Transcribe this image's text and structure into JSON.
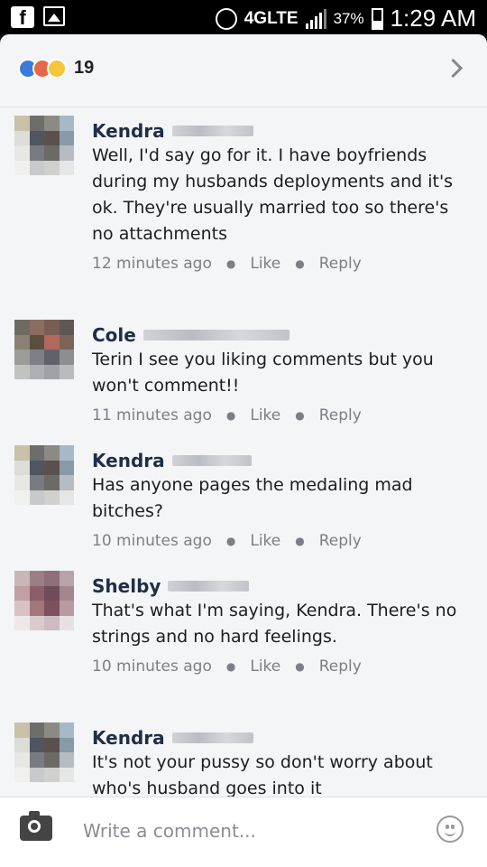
{
  "status_bar": {
    "network": "4GLTE",
    "battery": "37%",
    "time": "1:29 AM"
  },
  "reactions": {
    "icons": [
      "like-icon",
      "angry-icon",
      "haha-icon"
    ],
    "count": "19"
  },
  "comments": [
    {
      "name": "Kendra",
      "text": "Well, I'd say go for it. I have boyfriends during my husbands deployments and it's ok. They're usually married too so there's no attachments",
      "time": "12 minutes ago",
      "like": "Like",
      "reply": "Reply"
    },
    {
      "name": "Cole",
      "text": "Terin I see you liking comments but you won't comment!!",
      "time": "11 minutes ago",
      "like": "Like",
      "reply": "Reply"
    },
    {
      "name": "Kendra",
      "text": "Has anyone pages the medaling mad bitches?",
      "time": "10 minutes ago",
      "like": "Like",
      "reply": "Reply"
    },
    {
      "name": "Shelby",
      "text": "That's what I'm saying, Kendra. There's no strings and no hard feelings.",
      "time": "10 minutes ago",
      "like": "Like",
      "reply": "Reply"
    },
    {
      "name": "Kendra",
      "text": "It's not your pussy so don't worry about who's husband goes into it",
      "time": "",
      "like": "",
      "reply": ""
    }
  ],
  "composer": {
    "placeholder": "Write a comment..."
  },
  "colors": {
    "like": "#3b7bd9",
    "angry": "#e5684a",
    "haha": "#f5c53a",
    "name": "#1f2d47",
    "meta": "#7b7f86"
  }
}
